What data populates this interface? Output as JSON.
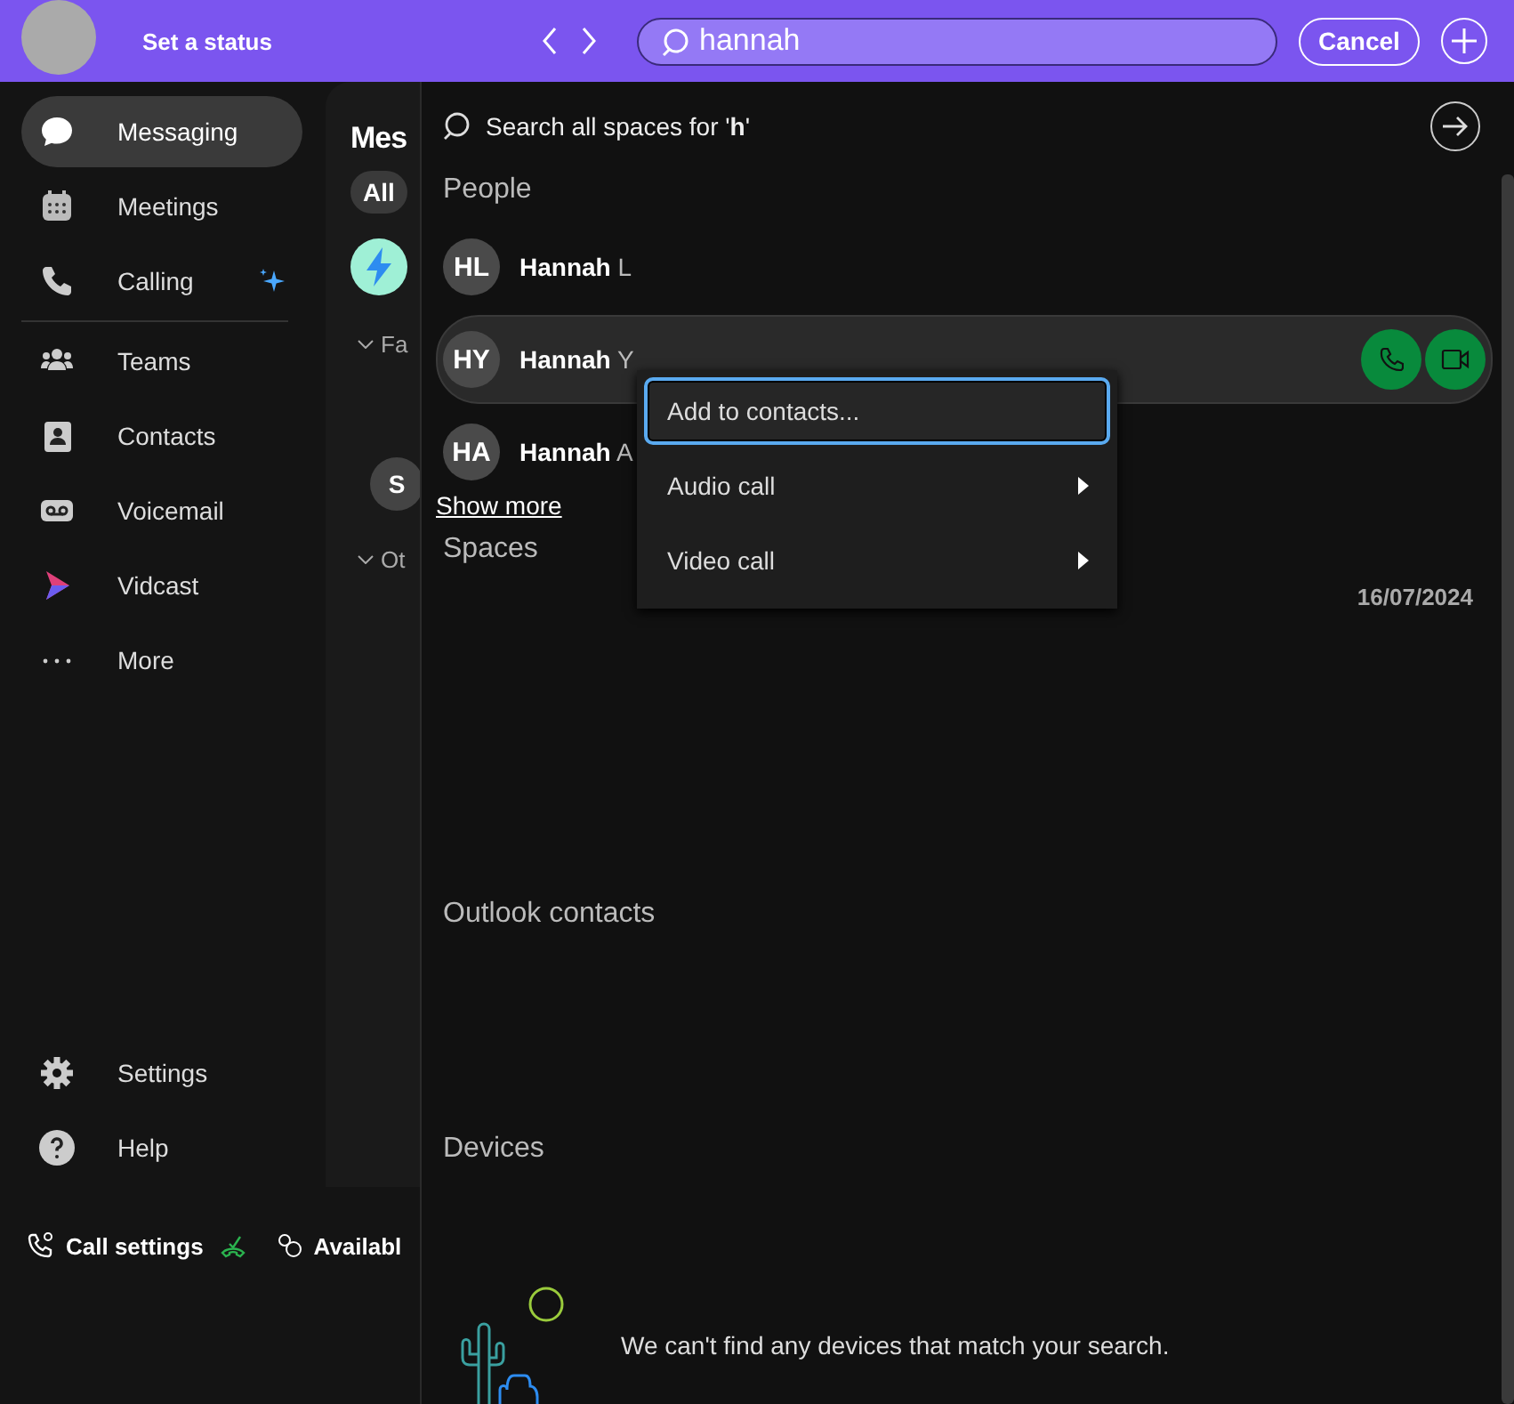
{
  "topbar": {
    "status": "Set a status",
    "search_value": "hannah",
    "cancel": "Cancel"
  },
  "nav": [
    {
      "label": "Messaging",
      "selected": true,
      "sparkle": false
    },
    {
      "label": "Meetings",
      "selected": false,
      "sparkle": false
    },
    {
      "label": "Calling",
      "selected": false,
      "sparkle": true
    },
    {
      "label": "Teams",
      "selected": false,
      "sparkle": false
    },
    {
      "label": "Contacts",
      "selected": false,
      "sparkle": false
    },
    {
      "label": "Voicemail",
      "selected": false,
      "sparkle": false
    },
    {
      "label": "Vidcast",
      "selected": false,
      "sparkle": false
    },
    {
      "label": "More",
      "selected": false,
      "sparkle": false
    }
  ],
  "nav_bottom": [
    {
      "label": "Settings"
    },
    {
      "label": "Help"
    }
  ],
  "status_bar": {
    "call_settings": "Call settings",
    "presence": "Availabl"
  },
  "middle": {
    "title": "Mes",
    "filter": "All",
    "sections": [
      "Fa",
      "Ot"
    ],
    "avatar": "S"
  },
  "search": {
    "search_all": "Search all spaces for '**h**'",
    "people_heading": "People",
    "people": [
      {
        "initials": "HL",
        "name": "**Hannah** L",
        "selected": false
      },
      {
        "initials": "HY",
        "name": "**Hannah** Y",
        "selected": true
      },
      {
        "initials": "HA",
        "name": "**Hannah** A",
        "selected": false
      }
    ],
    "show_more": "Show more",
    "spaces_heading": "Spaces",
    "date": "16/07/2024",
    "outlook_heading": "Outlook contacts",
    "devices_heading": "Devices",
    "devices_empty": "We can't find any devices that match your search."
  },
  "context_menu": [
    {
      "label": "Add to contacts...",
      "submenu": false,
      "focused": true
    },
    {
      "label": "Audio call",
      "submenu": true,
      "focused": false
    },
    {
      "label": "Video call",
      "submenu": true,
      "focused": false
    }
  ]
}
